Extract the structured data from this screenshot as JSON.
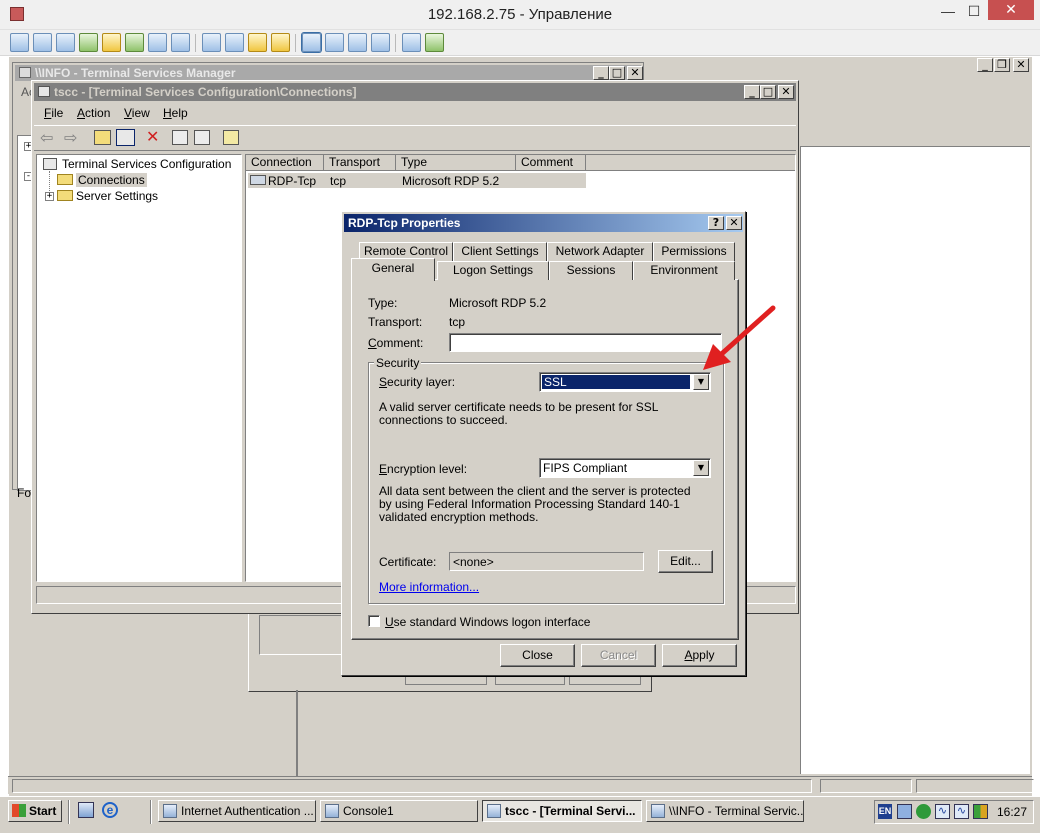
{
  "host": {
    "title": "192.168.2.75 - Управление",
    "window_buttons": {
      "minimize": "—",
      "maximize": "☐",
      "close": "✕"
    },
    "toolbar_icons": [
      "display-icon",
      "monitor-icon",
      "console-icon",
      "transfer-icon",
      "power-icon",
      "chat-icon",
      "phone-icon",
      "message-icon",
      "upload-icon",
      "network-icon",
      "lock-icon",
      "lock-icon",
      "fullscreen-icon",
      "scale-icon",
      "window-icon",
      "screenshot-icon",
      "settings-icon"
    ]
  },
  "tsm_window": {
    "title": "\\\\INFO - Terminal Services Manager",
    "menu_partial": "Ac",
    "status_partial": "For"
  },
  "tscc_window": {
    "title": "tscc - [Terminal Services Configuration\\Connections]",
    "menu": [
      {
        "label": "File",
        "key": "F"
      },
      {
        "label": "Action",
        "key": "A"
      },
      {
        "label": "View",
        "key": "V"
      },
      {
        "label": "Help",
        "key": "H"
      }
    ],
    "tree": {
      "root": "Terminal Services Configuration",
      "children": [
        "Connections",
        "Server Settings"
      ]
    },
    "list": {
      "headers": [
        "Connection",
        "Transport",
        "Type",
        "Comment"
      ],
      "rows": [
        {
          "connection": "RDP-Tcp",
          "transport": "tcp",
          "type": "Microsoft RDP 5.2",
          "comment": ""
        }
      ]
    }
  },
  "dialog": {
    "title": "RDP-Tcp Properties",
    "help_button": "?",
    "close_button": "✕",
    "tabs_back": [
      "Remote Control",
      "Client Settings",
      "Network Adapter",
      "Permissions"
    ],
    "tabs_front": [
      "General",
      "Logon Settings",
      "Sessions",
      "Environment"
    ],
    "active_tab": "General",
    "type_label": "Type:",
    "type_value": "Microsoft RDP 5.2",
    "transport_label": "Transport:",
    "transport_value": "tcp",
    "comment_label": "Comment:",
    "comment_value": "",
    "security_group": "Security",
    "security_layer_label": "Security layer:",
    "security_layer_value": "SSL",
    "security_layer_desc": "A valid server certificate needs to be present for SSL connections to succeed.",
    "encryption_label": "Encryption level:",
    "encryption_value": "FIPS Compliant",
    "encryption_desc": "All data sent between the client and the server is protected by using Federal Information Processing Standard 140-1 validated encryption methods.",
    "certificate_label": "Certificate:",
    "certificate_value": "<none>",
    "edit_button": "Edit...",
    "more_info_link": "More information...",
    "logon_checkbox_label": "Use standard Windows logon interface",
    "logon_checkbox_checked": false,
    "close": "Close",
    "cancel": "Cancel",
    "apply": "Apply"
  },
  "taskbar": {
    "start": "Start",
    "tasks": [
      {
        "label": "Internet Authentication ...",
        "active": false
      },
      {
        "label": "Console1",
        "active": false
      },
      {
        "label": "tscc - [Terminal Servi...",
        "active": true
      },
      {
        "label": "\\\\INFO - Terminal Servic...",
        "active": false
      }
    ],
    "language": "EN",
    "clock": "16:27"
  },
  "colors": {
    "classic_face": "#d4d0c8",
    "active_title": "#0a246a",
    "selection": "#0a246a",
    "annotation_arrow": "#e02020"
  }
}
